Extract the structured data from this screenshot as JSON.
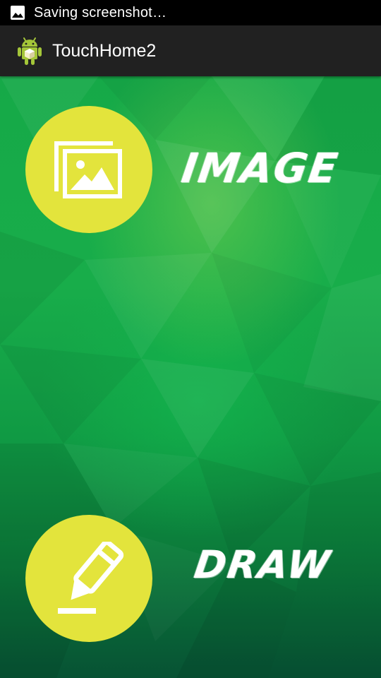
{
  "status_bar": {
    "icon": "image-icon",
    "text": "Saving screenshot…"
  },
  "action_bar": {
    "icon": "android-icon",
    "title": "TouchHome2"
  },
  "buttons": {
    "image": {
      "icon": "picture-gallery-icon",
      "label": "IMAGE"
    },
    "draw": {
      "icon": "pencil-icon",
      "label": "DRAW"
    }
  },
  "colors": {
    "accent_yellow": "#e3e43c",
    "background_green": "#16a948",
    "action_bar": "#212121",
    "status_bar": "#000000"
  }
}
